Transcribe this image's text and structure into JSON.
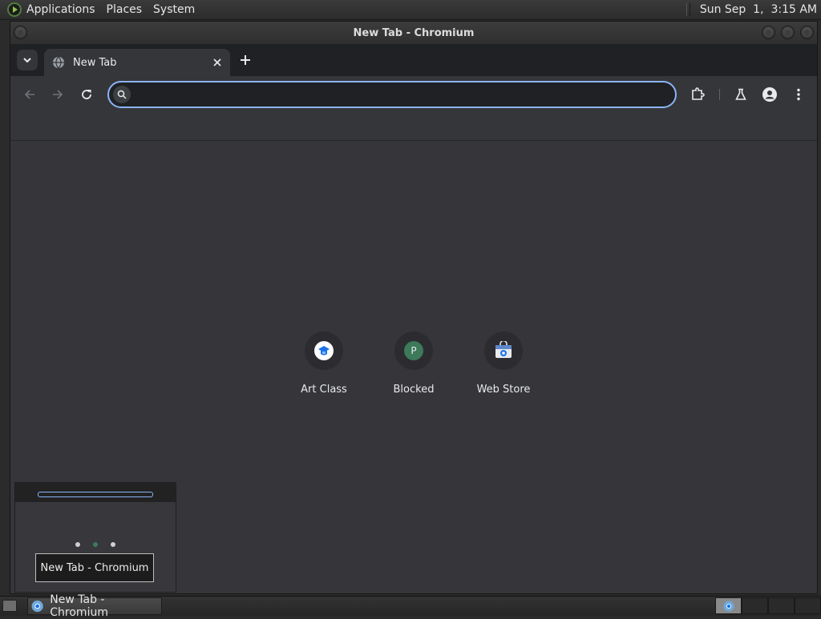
{
  "top_panel": {
    "menus": [
      "Applications",
      "Places",
      "System"
    ],
    "clock": "Sun Sep  1,  3:15 AM",
    "logo_icon": "distro-logo-icon"
  },
  "window": {
    "title": "New Tab - Chromium",
    "buttons": [
      "minimize",
      "maximize",
      "close"
    ]
  },
  "browser": {
    "tabs": [
      {
        "title": "New Tab",
        "active": true
      }
    ],
    "omnibox": {
      "value": "",
      "placeholder": ""
    },
    "toolbar_icons": [
      "back-icon",
      "forward-icon",
      "reload-icon",
      "extensions-icon",
      "labs-icon",
      "profile-icon",
      "menu-icon"
    ]
  },
  "ntp": {
    "shortcuts": [
      {
        "label": "Art Class",
        "icon": "art-class-icon"
      },
      {
        "label": "Blocked",
        "icon": "letter-p-icon",
        "letter": "P"
      },
      {
        "label": "Web Store",
        "icon": "web-store-icon"
      }
    ]
  },
  "tooltip": {
    "text": "New Tab - Chromium"
  },
  "taskbar": {
    "tasks": [
      {
        "label": "New Tab - Chromium"
      }
    ]
  },
  "colors": {
    "accent": "#8ab4f8",
    "ntp_bg": "#36363a",
    "toolbar": "#35363a",
    "tabstrip": "#202124"
  }
}
